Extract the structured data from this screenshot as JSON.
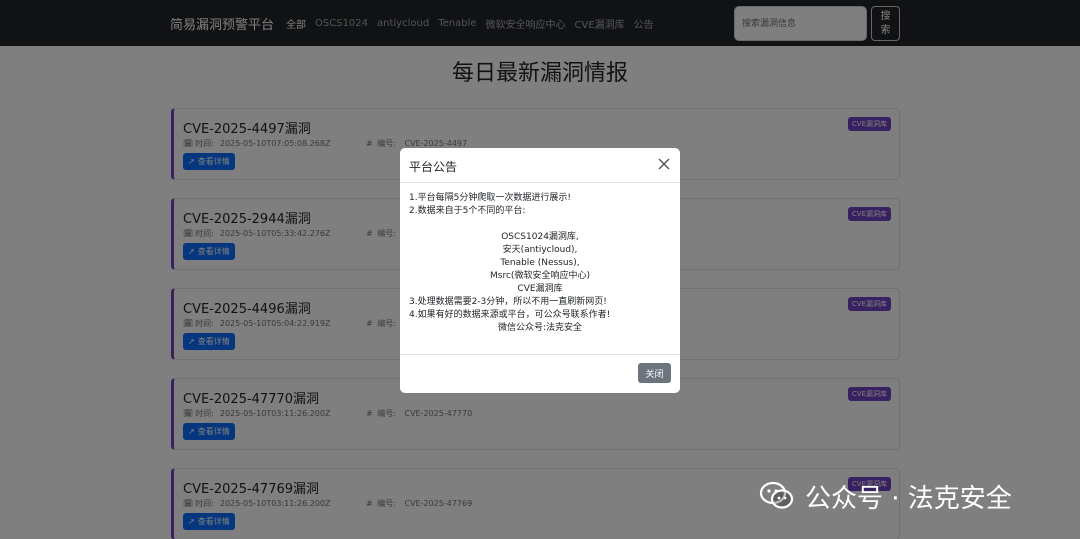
{
  "navbar": {
    "brand": "简易漏洞预警平台",
    "links": [
      "全部",
      "OSCS1024",
      "antiycloud",
      "Tenable",
      "微软安全响应中心",
      "CVE漏洞库",
      "公告"
    ],
    "search_placeholder": "搜索漏洞信息",
    "search_button": "搜\n索"
  },
  "page_title": "每日最新漏洞情报",
  "meta_labels": {
    "time": "时间:",
    "id": "编号:"
  },
  "cards": [
    {
      "title": "CVE-2025-4497漏洞",
      "badge": "CVE漏洞库",
      "time": "2025-05-10T07:05:08.268Z",
      "id": "CVE-2025-4497",
      "button": "查看详情"
    },
    {
      "title": "CVE-2025-2944漏洞",
      "badge": "CVE漏洞库",
      "time": "2025-05-10T05:33:42.276Z",
      "id": "CVE-2025-2944",
      "button": "查看详情"
    },
    {
      "title": "CVE-2025-4496漏洞",
      "badge": "CVE漏洞库",
      "time": "2025-05-10T05:04:22.919Z",
      "id": "CVE-2025-4496",
      "button": "查看详情"
    },
    {
      "title": "CVE-2025-47770漏洞",
      "badge": "CVE漏洞库",
      "time": "2025-05-10T03:11:26.200Z",
      "id": "CVE-2025-47770",
      "button": "查看详情"
    },
    {
      "title": "CVE-2025-47769漏洞",
      "badge": "CVE漏洞库",
      "time": "2025-05-10T03:11:26.200Z",
      "id": "CVE-2025-47769",
      "button": "查看详情"
    }
  ],
  "modal": {
    "title": "平台公告",
    "lines": [
      "1.平台每隔5分钟爬取一次数据进行展示!",
      "2.数据来自于5个不同的平台:",
      "",
      "OSCS1024漏洞库,",
      "安天(antiycloud),",
      "Tenable (Nessus),",
      "Msrc(微软安全响应中心)",
      "CVE漏洞库",
      "3.处理数据需要2-3分钟，所以不用一直刷新网页!",
      "4.如果有好的数据来源或平台，可公众号联系作者!",
      "微信公众号:法克安全"
    ],
    "close_button": "关闭"
  },
  "watermark": {
    "text": "公众号 · 法克安全"
  }
}
